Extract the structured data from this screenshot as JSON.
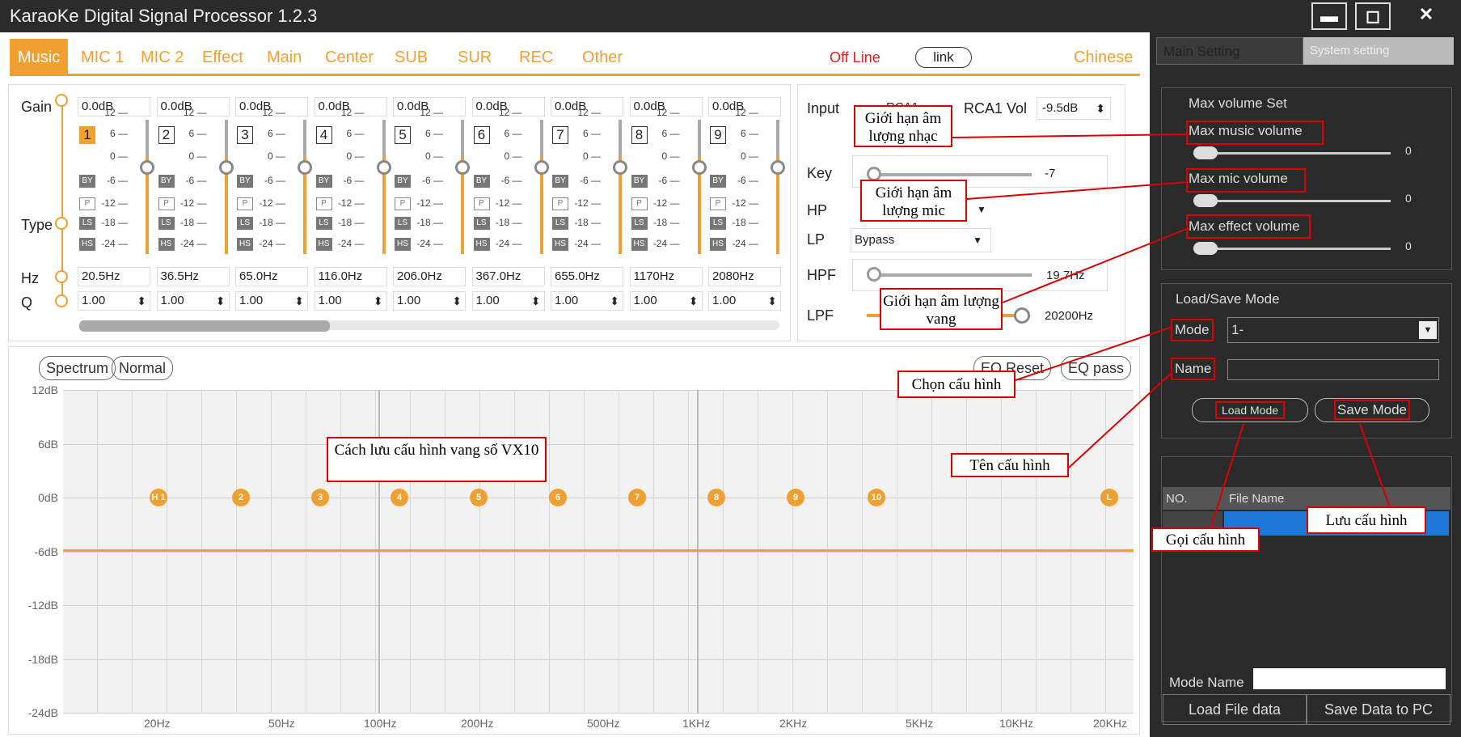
{
  "title": "KaraoKe Digital Signal Processor 1.2.3",
  "window_buttons": [
    "▬",
    "◻",
    "✕"
  ],
  "tabs": [
    "Music",
    "MIC 1",
    "MIC 2",
    "Effect",
    "Main",
    "Center",
    "SUB",
    "SUR",
    "REC",
    "Other"
  ],
  "status": {
    "offline": "Off Line",
    "link": "link",
    "language": "Chinese"
  },
  "eq": {
    "row_labels": {
      "gain": "Gain",
      "type": "Type",
      "hz": "Hz",
      "q": "Q"
    },
    "scale": [
      "12 —",
      "6 —",
      "0 —",
      "-6 —",
      "-12 —",
      "-18 —",
      "-24 —"
    ],
    "type_buttons": [
      "BY",
      "P",
      "LS",
      "HS"
    ],
    "bands": [
      {
        "num": "1",
        "gain": "0.0dB",
        "hz": "20.5Hz",
        "q": "1.00"
      },
      {
        "num": "2",
        "gain": "0.0dB",
        "hz": "36.5Hz",
        "q": "1.00"
      },
      {
        "num": "3",
        "gain": "0.0dB",
        "hz": "65.0Hz",
        "q": "1.00"
      },
      {
        "num": "4",
        "gain": "0.0dB",
        "hz": "116.0Hz",
        "q": "1.00"
      },
      {
        "num": "5",
        "gain": "0.0dB",
        "hz": "206.0Hz",
        "q": "1.00"
      },
      {
        "num": "6",
        "gain": "0.0dB",
        "hz": "367.0Hz",
        "q": "1.00"
      },
      {
        "num": "7",
        "gain": "0.0dB",
        "hz": "655.0Hz",
        "q": "1.00"
      },
      {
        "num": "8",
        "gain": "0.0dB",
        "hz": "1170Hz",
        "q": "1.00"
      },
      {
        "num": "9",
        "gain": "0.0dB",
        "hz": "2080Hz",
        "q": "1.00"
      }
    ],
    "spin_glyph": "⬍"
  },
  "input_panel": {
    "input_label": "Input",
    "input_value": "RCA1",
    "rca_label": "RCA1 Vol",
    "rca_value": "-9.5dB",
    "key_label": "Key",
    "key_value": "-7",
    "hp_label": "HP",
    "lp_label": "LP",
    "lp_value": "Bypass",
    "hpf_label": "HPF",
    "hpf_value": "19.7Hz",
    "lpf_label": "LPF",
    "lpf_value": "20200Hz"
  },
  "graph": {
    "spectrum": "Spectrum",
    "normal": "Normal",
    "eq_reset": "EQ Reset",
    "eq_pass": "EQ pass",
    "y_ticks": [
      "12dB",
      "6dB",
      "0dB",
      "-6dB",
      "-12dB",
      "-18dB",
      "-24dB"
    ],
    "x_ticks": [
      "20Hz",
      "50Hz",
      "100Hz",
      "200Hz",
      "500Hz",
      "1KHz",
      "2KHz",
      "5KHz",
      "10KHz",
      "20KHz"
    ],
    "nodes": [
      "H 1",
      "2",
      "3",
      "4",
      "5",
      "6",
      "7",
      "8",
      "9",
      "10",
      "L"
    ]
  },
  "right": {
    "tab_main": "Main Setting",
    "tab_system": "System setting",
    "max_volume_title": "Max volume Set",
    "sliders": [
      {
        "label": "Max music volume",
        "value": "0"
      },
      {
        "label": "Max mic volume",
        "value": "0"
      },
      {
        "label": "Max effect volume",
        "value": "0"
      }
    ],
    "load_save_title": "Load/Save Mode",
    "mode_label": "Mode",
    "mode_value": "1-",
    "name_label": "Name",
    "load_mode": "Load Mode",
    "save_mode": "Save Mode",
    "col_no": "NO.",
    "col_file": "File Name",
    "mode_name_label": "Mode Name",
    "load_file": "Load File data",
    "save_pc": "Save Data to PC"
  },
  "annotations": {
    "music_limit": "Giới hạn âm lượng nhạc",
    "mic_limit": "Giới hạn âm lượng mic",
    "effect_limit": "Giới hạn âm lượng vang",
    "choose_config": "Chọn cấu hình",
    "config_name": "Tên cấu hình",
    "how_save": "Cách lưu cấu hình vang số VX10",
    "call_config": "Gọi cấu hình",
    "save_config": "Lưu cấu hình"
  },
  "colors": {
    "accent": "#f0a030",
    "annotation": "#dd0000",
    "dark": "#2a2a2a",
    "selected": "#1e78d8"
  }
}
